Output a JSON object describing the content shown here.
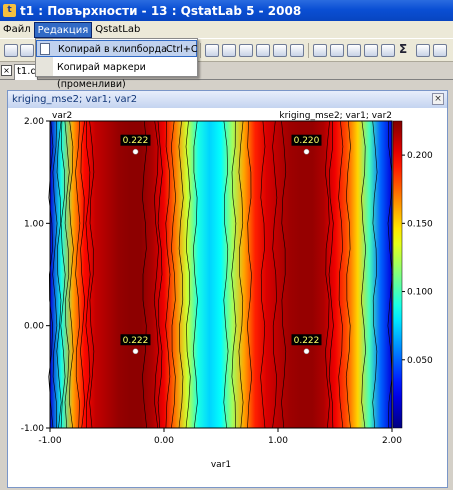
{
  "window": {
    "title": "t1 : Повърхности - 13 : QstatLab 5 - 2008",
    "icon": "app-icon"
  },
  "menu": {
    "items": [
      "Файл",
      "Редакция",
      "QstatLab"
    ],
    "active_index": 1
  },
  "dropdown": {
    "items": [
      {
        "label": "Копирай в клипборда",
        "shortcut": "Ctrl+C",
        "icon": "copy-icon"
      },
      {
        "label": "Копирай маркери (променливи)",
        "shortcut": ""
      }
    ]
  },
  "tabstrip": {
    "tab_label": "t1.qs",
    "close_icon": "×"
  },
  "plot_window": {
    "title": "kriging_mse2; var1; var2",
    "close_icon": "×"
  },
  "chart_data": {
    "type": "heatmap",
    "title": "kriging_mse2; var1; var2",
    "xlabel": "var1",
    "ylabel": "var2",
    "xlim": [
      -1.0,
      2.0
    ],
    "ylim": [
      -1.0,
      2.0
    ],
    "x_ticks": [
      "-1.00",
      "0.00",
      "1.00",
      "2.00"
    ],
    "y_ticks": [
      "-1.00",
      "0.00",
      "1.00",
      "2.00"
    ],
    "colorbar": {
      "ticks": [
        "0.200",
        "0.150",
        "0.100",
        "0.050"
      ],
      "tick_values": [
        0.2,
        0.15,
        0.1,
        0.05
      ],
      "range": [
        0.0,
        0.225
      ]
    },
    "markers": [
      {
        "x": -0.25,
        "y": 1.7,
        "label": "0.222"
      },
      {
        "x": 1.25,
        "y": 1.7,
        "label": "0.220"
      },
      {
        "x": -0.25,
        "y": -0.25,
        "label": "0.222"
      },
      {
        "x": 1.25,
        "y": -0.25,
        "label": "0.222"
      }
    ],
    "column_profile": {
      "x": [
        -1.0,
        -0.9,
        -0.8,
        -0.7,
        -0.6,
        -0.5,
        -0.4,
        -0.3,
        -0.2,
        -0.1,
        0.0,
        0.1,
        0.2,
        0.3,
        0.4,
        0.5,
        0.6,
        0.7,
        0.8,
        0.9,
        1.0,
        1.1,
        1.2,
        1.3,
        1.4,
        1.5,
        1.6,
        1.7,
        1.8,
        1.9,
        2.0
      ],
      "value": [
        0.02,
        0.09,
        0.16,
        0.195,
        0.21,
        0.215,
        0.22,
        0.222,
        0.222,
        0.215,
        0.2,
        0.17,
        0.13,
        0.09,
        0.075,
        0.085,
        0.12,
        0.16,
        0.19,
        0.205,
        0.212,
        0.218,
        0.22,
        0.22,
        0.215,
        0.2,
        0.18,
        0.15,
        0.1,
        0.05,
        0.02
      ]
    },
    "legend": "right colorbar"
  },
  "colors": {
    "titlebar": "#0a4fd4",
    "menu_highlight": "#316ac5",
    "marker_label_bg": "#000000",
    "marker_label_text": "#ffff66"
  }
}
